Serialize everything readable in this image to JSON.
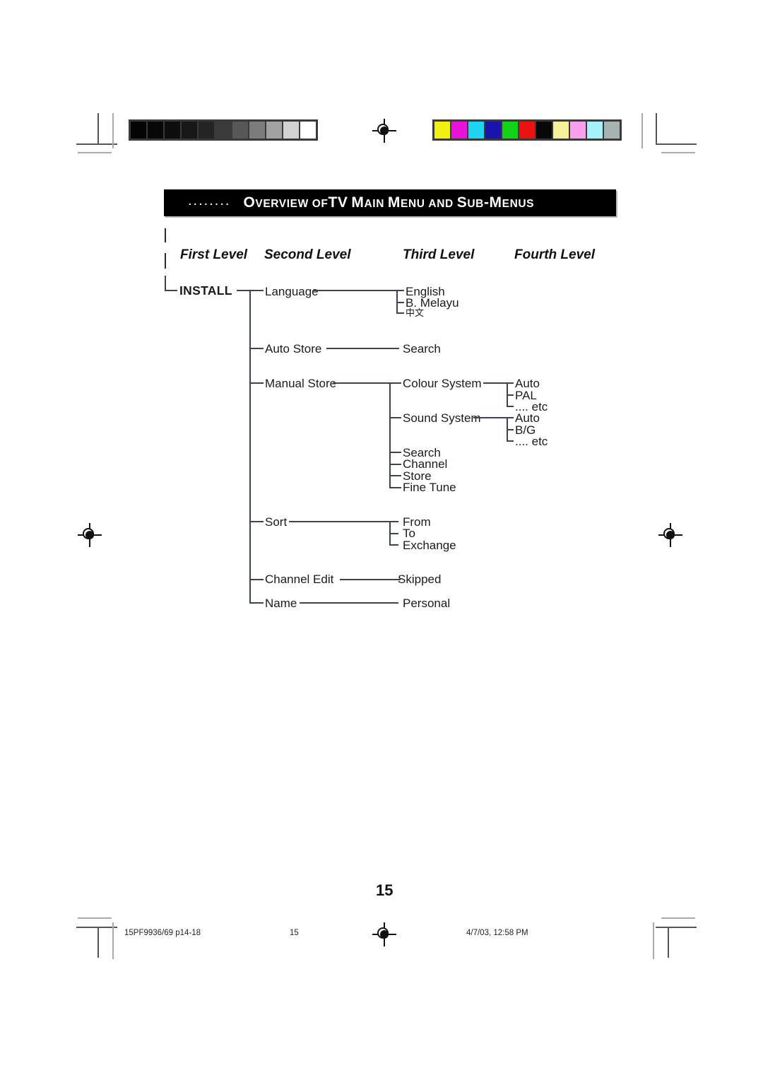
{
  "document": {
    "page_number": "15",
    "footer_left": "15PF9936/69 p14-18",
    "footer_center": "15",
    "footer_right": "4/7/03, 12:58 PM"
  },
  "header": {
    "leading_dots": "........",
    "title_parts": [
      {
        "cap": "O",
        "rest": "VERVIEW"
      },
      {
        "cap": "",
        "rest": "OF"
      },
      {
        "cap": "TV",
        "rest": ""
      },
      {
        "cap": "M",
        "rest": "AIN"
      },
      {
        "cap": "M",
        "rest": "ENU"
      },
      {
        "cap": "",
        "rest": "AND"
      },
      {
        "cap": "S",
        "rest": "UB"
      },
      {
        "cap": "-M",
        "rest": "ENUS"
      }
    ],
    "title_plain": "Overview of TV Main Menu and Sub-Menus",
    "background_color": "#000000",
    "text_color": "#ffffff"
  },
  "columns": {
    "first": "First Level",
    "second": "Second Level",
    "third": "Third Level",
    "fourth": "Fourth Level"
  },
  "tree": {
    "root": "INSTALL",
    "level2": {
      "language": "Language",
      "auto_store": "Auto Store",
      "manual_store": "Manual Store",
      "sort": "Sort",
      "channel_edit": "Channel Edit",
      "name": "Name"
    },
    "language_options": [
      "English",
      "B. Melayu",
      "中文"
    ],
    "auto_store_options": [
      "Search"
    ],
    "manual_store_options": {
      "colour_system": "Colour System",
      "sound_system": "Sound System",
      "search": "Search",
      "channel": "Channel",
      "store": "Store",
      "fine_tune": "Fine Tune"
    },
    "colour_system_values": [
      "Auto",
      "PAL",
      ".... etc"
    ],
    "sound_system_values": [
      "Auto",
      "B/G",
      ".... etc"
    ],
    "sort_options": [
      "From",
      "To",
      "Exchange"
    ],
    "channel_edit_options": [
      "Skipped"
    ],
    "name_options": [
      "Personal"
    ]
  },
  "calibration": {
    "grayscale": [
      "#040404",
      "#080808",
      "#0d0d0d",
      "#171717",
      "#242424",
      "#3b3b3b",
      "#575757",
      "#7c7c7c",
      "#a2a2a2",
      "#d2d2d2",
      "#ffffff"
    ],
    "colors": [
      "#f2ef12",
      "#e812d8",
      "#1fd4f2",
      "#1a13ad",
      "#11d417",
      "#ec1212",
      "#080808",
      "#f5f09a",
      "#fba0ef",
      "#a6f2fb",
      "#a5b3b3"
    ]
  }
}
